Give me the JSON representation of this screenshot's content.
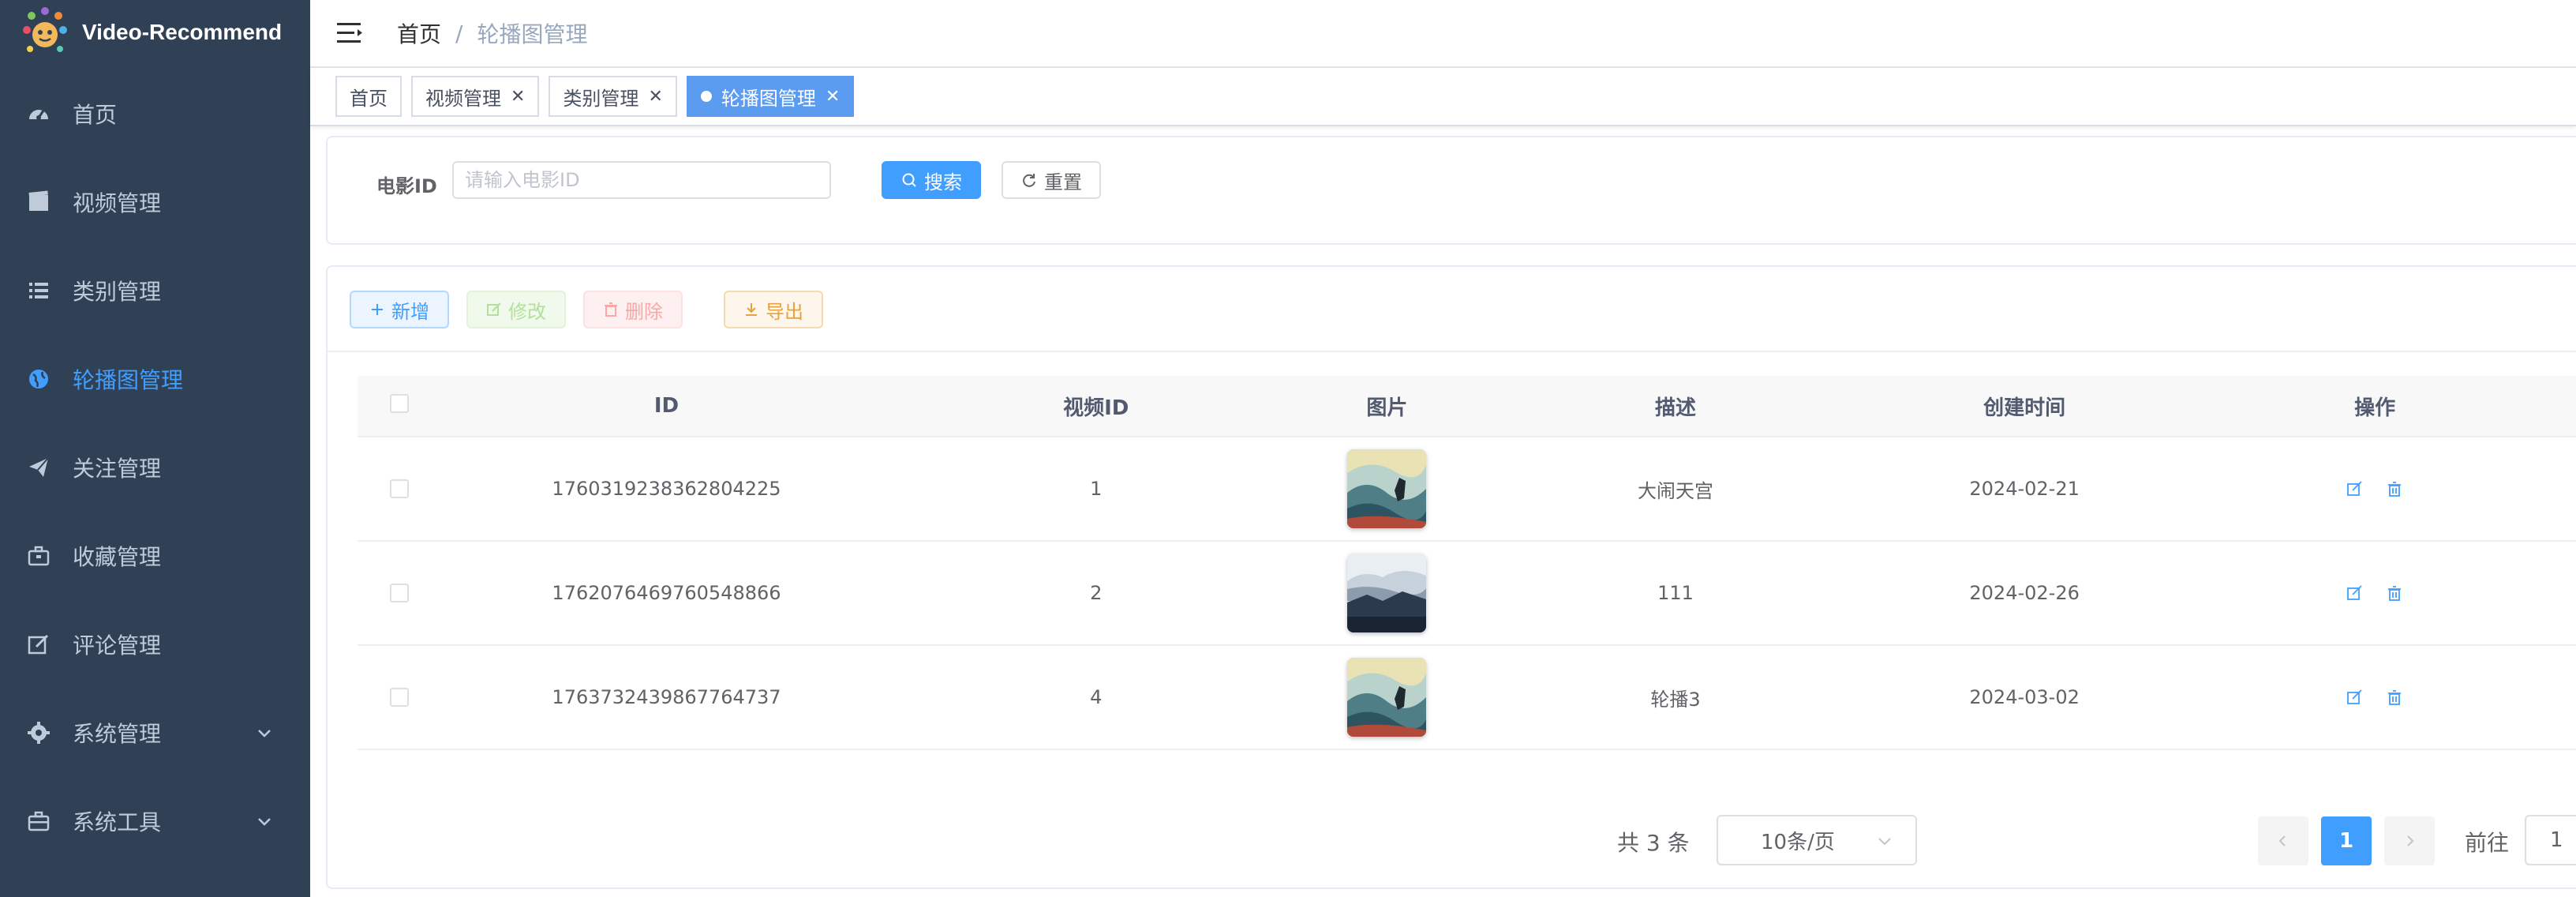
{
  "app": {
    "title": "Video-Recommend"
  },
  "sidebar": {
    "items": [
      {
        "label": "首页",
        "icon": "dashboard-icon"
      },
      {
        "label": "视频管理",
        "icon": "film-icon"
      },
      {
        "label": "类别管理",
        "icon": "list-icon"
      },
      {
        "label": "轮播图管理",
        "icon": "globe-icon",
        "active": true
      },
      {
        "label": "关注管理",
        "icon": "paper-plane-icon"
      },
      {
        "label": "收藏管理",
        "icon": "briefcase-icon"
      },
      {
        "label": "评论管理",
        "icon": "edit-icon"
      },
      {
        "label": "系统管理",
        "icon": "gear-icon",
        "expandable": true
      },
      {
        "label": "系统工具",
        "icon": "toolbox-icon",
        "expandable": true
      }
    ]
  },
  "breadcrumb": {
    "home": "首页",
    "separator": "/",
    "current": "轮播图管理"
  },
  "tags": [
    {
      "label": "首页",
      "closable": false
    },
    {
      "label": "视频管理",
      "closable": true
    },
    {
      "label": "类别管理",
      "closable": true
    },
    {
      "label": "轮播图管理",
      "closable": true,
      "active": true
    }
  ],
  "search": {
    "label": "电影ID",
    "placeholder": "请输入电影ID",
    "value": "",
    "search_label": "搜索",
    "reset_label": "重置"
  },
  "toolbar": {
    "add_label": "新增",
    "edit_label": "修改",
    "delete_label": "删除",
    "export_label": "导出"
  },
  "table": {
    "columns": [
      "ID",
      "视频ID",
      "图片",
      "描述",
      "创建时间",
      "操作"
    ],
    "rows": [
      {
        "id": "1760319238362804225",
        "video_id": "1",
        "image": "painting-thumbnail",
        "desc": "大闹天宫",
        "created": "2024-02-21"
      },
      {
        "id": "1762076469760548866",
        "video_id": "2",
        "image": "mountain-thumbnail",
        "desc": "111",
        "created": "2024-02-26"
      },
      {
        "id": "1763732439867764737",
        "video_id": "4",
        "image": "painting-thumbnail",
        "desc": "轮播3",
        "created": "2024-03-02"
      }
    ]
  },
  "pagination": {
    "total_text": "共 3 条",
    "page_size": "10条/页",
    "current_page": "1",
    "goto_label": "前往",
    "goto_value": "1"
  },
  "colors": {
    "sidebar_bg": "#304156",
    "primary": "#409eff",
    "active_tag": "#5b9bf0"
  }
}
